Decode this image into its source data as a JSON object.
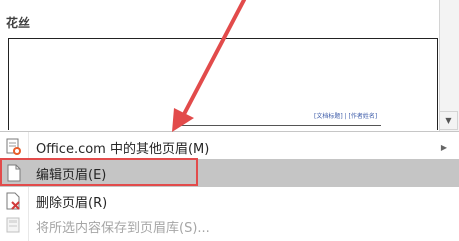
{
  "gallery": {
    "section_label": "花丝",
    "header_placeholder": "[文档标题] | [作者姓名]",
    "scroll_down_icon": "triangle-down-icon"
  },
  "menu": {
    "items": [
      {
        "label": "Office.com 中的其他页眉(M)",
        "icon": "office-doc-icon",
        "submenu": true,
        "enabled": true
      },
      {
        "label": "编辑页眉(E)",
        "icon": "blank-page-icon",
        "submenu": false,
        "enabled": true,
        "highlighted": true
      },
      {
        "label": "删除页眉(R)",
        "icon": "delete-page-icon",
        "submenu": false,
        "enabled": true
      },
      {
        "label": "将所选内容保存到页眉库(S)...",
        "icon": "save-selection-icon",
        "submenu": false,
        "enabled": false
      }
    ]
  },
  "colors": {
    "annotation_red": "#e24b4b",
    "hover_gray": "#c5c5c5",
    "disabled_text": "#a6a6a6"
  }
}
